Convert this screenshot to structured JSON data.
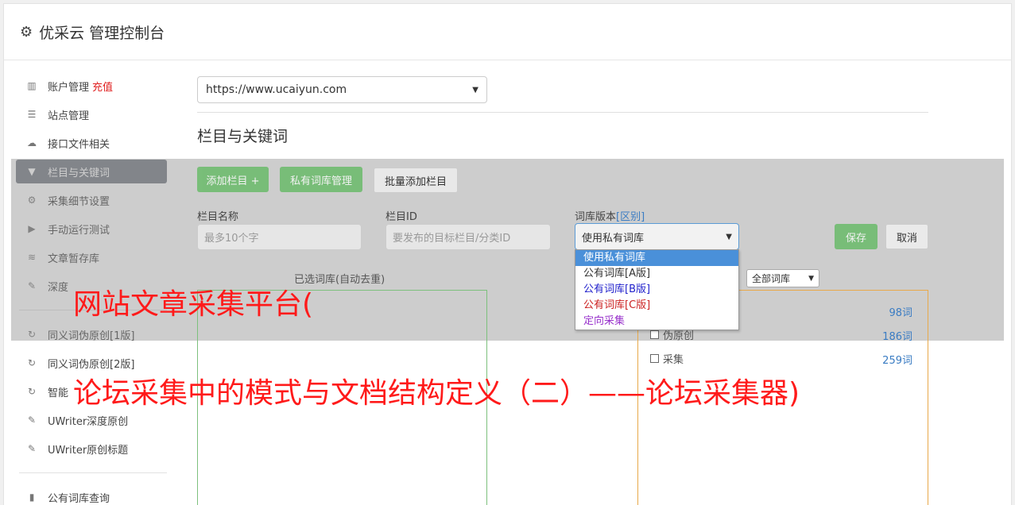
{
  "app": {
    "title": "优采云 管理控制台",
    "icon": "gear-icon"
  },
  "sidebar": {
    "items": [
      {
        "label": "账户管理",
        "badge": "充值",
        "icon": "bar-chart-icon",
        "glyph": "▥"
      },
      {
        "label": "站点管理",
        "icon": "server-icon",
        "glyph": "☰"
      },
      {
        "label": "接口文件相关",
        "icon": "cloud-upload-icon",
        "glyph": "☁"
      },
      {
        "label": "栏目与关键词",
        "icon": "filter-icon",
        "glyph": "▼",
        "active": true
      },
      {
        "label": "采集细节设置",
        "icon": "cogs-icon",
        "glyph": "⚙"
      },
      {
        "label": "手动运行测试",
        "icon": "play-circle-icon",
        "glyph": "▶"
      },
      {
        "label": "文章暂存库",
        "icon": "database-icon",
        "glyph": "≋"
      },
      {
        "label": "深度",
        "icon": "edit-icon",
        "glyph": "✎"
      },
      {
        "label": "同义词伪原创[1版]",
        "icon": "refresh-icon",
        "glyph": "↻"
      },
      {
        "label": "同义词伪原创[2版]",
        "icon": "refresh-icon",
        "glyph": "↻"
      },
      {
        "label": "智能",
        "icon": "refresh-icon",
        "glyph": "↻"
      },
      {
        "label": "UWriter深度原创",
        "icon": "edit-icon",
        "glyph": "✎"
      },
      {
        "label": "UWriter原创标题",
        "icon": "edit-icon",
        "glyph": "✎"
      },
      {
        "label": "公有词库查询",
        "icon": "book-icon",
        "glyph": "▮"
      }
    ]
  },
  "main": {
    "site_select": "https://www.ucaiyun.com",
    "section_title": "栏目与关键词",
    "buttons": {
      "add_column": "添加栏目 +",
      "private_lib": "私有词库管理",
      "batch_add": "批量添加栏目",
      "save": "保存",
      "cancel": "取消"
    },
    "form": {
      "name_label": "栏目名称",
      "name_placeholder": "最多10个字",
      "id_label": "栏目ID",
      "id_placeholder": "要发布的目标栏目/分类ID",
      "version_label": "词库版本",
      "version_link": "[区别]",
      "version_value": "使用私有词库"
    },
    "dropdown_options": [
      {
        "label": "使用私有词库",
        "color": "#ffffff"
      },
      {
        "label": "公有词库[A版]",
        "color": "#333333"
      },
      {
        "label": "公有词库[B版]",
        "color": "#2222cc"
      },
      {
        "label": "公有词库[C版]",
        "color": "#cc2222"
      },
      {
        "label": "定向采集",
        "color": "#9933cc"
      }
    ],
    "selected_label": "已选词库(自动去重)",
    "all_lib_select": "全部词库",
    "lib_rows": [
      {
        "label": "",
        "count": "98词"
      },
      {
        "label": "伪原创",
        "count": "186词"
      },
      {
        "label": "采集",
        "count": "259词"
      }
    ]
  },
  "watermarks": {
    "line1": "网站文章采集平台(",
    "line2": "论坛采集中的模式与文档结构定义（二）——论坛采集器)"
  }
}
